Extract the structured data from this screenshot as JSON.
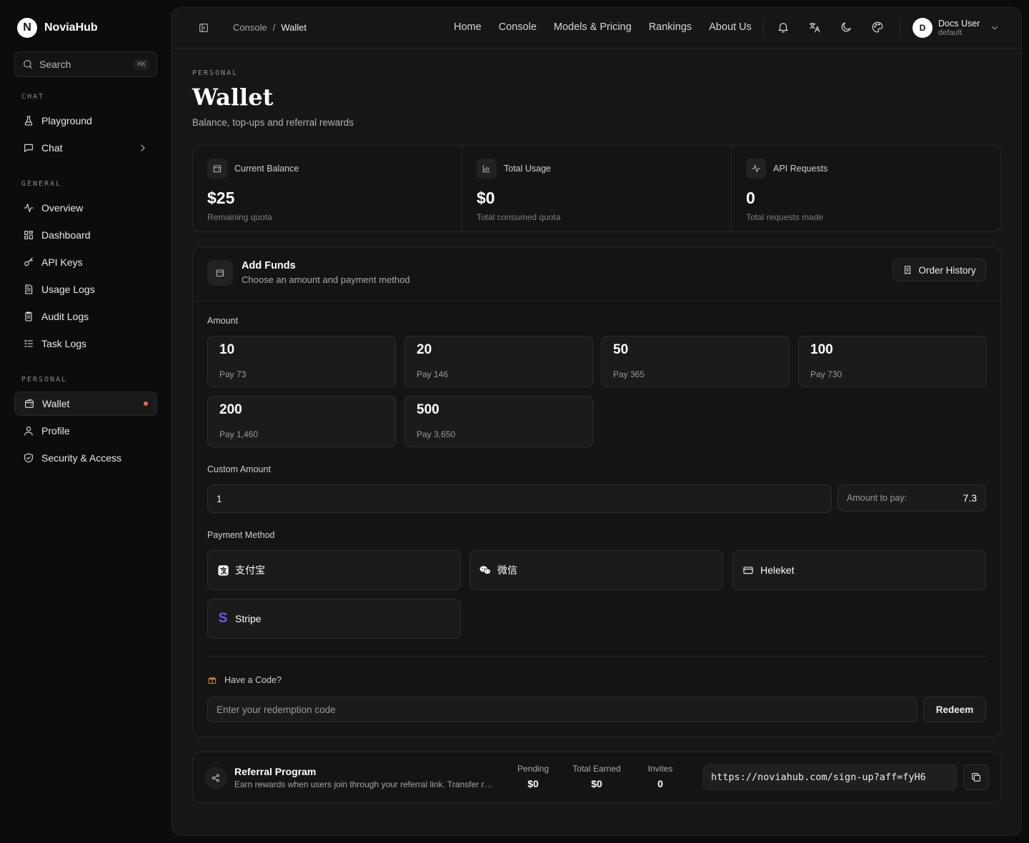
{
  "brand": {
    "logo_letter": "N",
    "name": "NoviaHub"
  },
  "search": {
    "label": "Search",
    "shortcut": "⌘K"
  },
  "sidebar": {
    "sections": [
      {
        "label": "CHAT",
        "items": [
          {
            "label": "Playground",
            "icon": "flask-icon"
          },
          {
            "label": "Chat",
            "icon": "message-icon",
            "has_children": true
          }
        ]
      },
      {
        "label": "GENERAL",
        "items": [
          {
            "label": "Overview",
            "icon": "activity-icon"
          },
          {
            "label": "Dashboard",
            "icon": "grid-icon"
          },
          {
            "label": "API Keys",
            "icon": "key-icon"
          },
          {
            "label": "Usage Logs",
            "icon": "file-text-icon"
          },
          {
            "label": "Audit Logs",
            "icon": "clipboard-icon"
          },
          {
            "label": "Task Logs",
            "icon": "list-check-icon"
          }
        ]
      },
      {
        "label": "PERSONAL",
        "items": [
          {
            "label": "Wallet",
            "icon": "wallet-icon",
            "active": true
          },
          {
            "label": "Profile",
            "icon": "user-icon"
          },
          {
            "label": "Security & Access",
            "icon": "shield-icon"
          }
        ]
      }
    ]
  },
  "breadcrumb": {
    "parent": "Console",
    "separator": "/",
    "current": "Wallet"
  },
  "topnav": [
    "Home",
    "Console",
    "Models & Pricing",
    "Rankings",
    "About Us"
  ],
  "user": {
    "initial": "D",
    "name": "Docs User",
    "group": "default"
  },
  "page": {
    "eyebrow": "PERSONAL",
    "title": "Wallet",
    "subtitle": "Balance, top-ups and referral rewards"
  },
  "stats": [
    {
      "label": "Current Balance",
      "value": "$25",
      "sub": "Remaining quota",
      "icon": "wallet-icon"
    },
    {
      "label": "Total Usage",
      "value": "$0",
      "sub": "Total consumed quota",
      "icon": "bar-chart-icon"
    },
    {
      "label": "API Requests",
      "value": "0",
      "sub": "Total requests made",
      "icon": "activity-icon"
    }
  ],
  "funds": {
    "title": "Add Funds",
    "subtitle": "Choose an amount and payment method",
    "order_history": "Order History",
    "amount_label": "Amount",
    "amounts": [
      {
        "value": "10",
        "pay": "Pay 73"
      },
      {
        "value": "20",
        "pay": "Pay 146"
      },
      {
        "value": "50",
        "pay": "Pay 365"
      },
      {
        "value": "100",
        "pay": "Pay 730"
      },
      {
        "value": "200",
        "pay": "Pay 1,460"
      },
      {
        "value": "500",
        "pay": "Pay 3,650"
      }
    ],
    "custom_label": "Custom Amount",
    "custom_value": "1",
    "pay_label": "Amount to pay:",
    "pay_value": "7.3",
    "method_label": "Payment Method",
    "methods": [
      {
        "label": "支付宝",
        "icon": "alipay-icon"
      },
      {
        "label": "微信",
        "icon": "wechat-icon"
      },
      {
        "label": "Heleket",
        "icon": "credit-card-icon"
      },
      {
        "label": "Stripe",
        "icon": "stripe-icon"
      }
    ],
    "code_label": "Have a Code?",
    "code_placeholder": "Enter your redemption code",
    "redeem": "Redeem"
  },
  "referral": {
    "title": "Referral Program",
    "subtitle": "Earn rewards when users join through your referral link. Transfer rewards to your balance anytime.",
    "metrics": [
      {
        "label": "Pending",
        "value": "$0"
      },
      {
        "label": "Total Earned",
        "value": "$0"
      },
      {
        "label": "Invites",
        "value": "0"
      }
    ],
    "link": "https://noviahub.com/sign-up?aff=fyH6"
  },
  "colors": {
    "accent_dot": "#f26a3a",
    "stripe": "#6b5cf6",
    "gift": "#e59a3a"
  }
}
